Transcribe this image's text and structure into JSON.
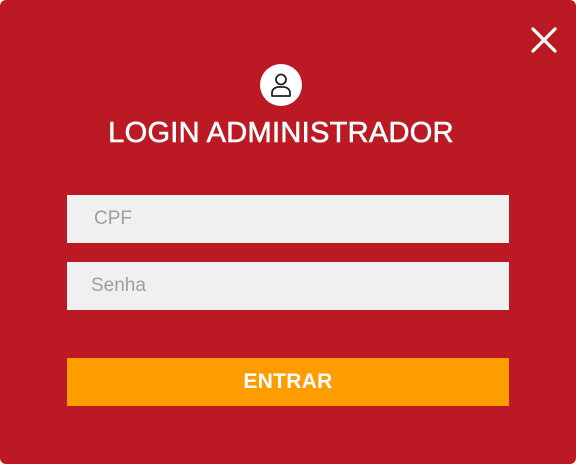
{
  "modal": {
    "title": "LOGIN ADMINISTRADOR",
    "background_color": "#bb1923",
    "close_icon": "close-icon",
    "avatar_icon": "user-icon"
  },
  "form": {
    "cpf": {
      "value": "",
      "placeholder": "CPF"
    },
    "password": {
      "value": "",
      "placeholder": "Senha"
    },
    "submit_label": "ENTRAR",
    "submit_color": "#ff9c00"
  }
}
